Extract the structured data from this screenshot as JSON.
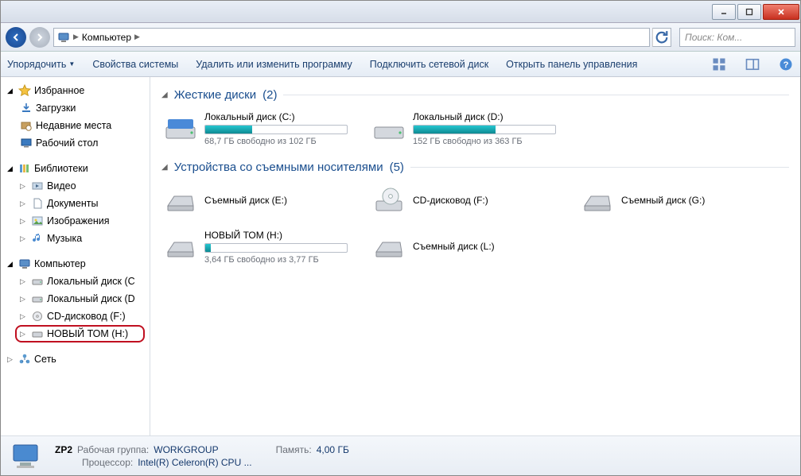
{
  "titlebar": {
    "minimize": "_",
    "maximize": "▢",
    "close": "✕"
  },
  "nav": {
    "breadcrumb_root_icon": "computer",
    "breadcrumb_label": "Компьютер",
    "search_placeholder": "Поиск: Ком..."
  },
  "toolbar": {
    "organize": "Упорядочить",
    "sys_props": "Свойства системы",
    "uninstall": "Удалить или изменить программу",
    "map_drive": "Подключить сетевой диск",
    "control_panel": "Открыть панель управления"
  },
  "sidebar": {
    "favorites": {
      "label": "Избранное",
      "items": [
        {
          "icon": "download",
          "label": "Загрузки"
        },
        {
          "icon": "recent",
          "label": "Недавние места"
        },
        {
          "icon": "desktop",
          "label": "Рабочий стол"
        }
      ]
    },
    "libraries": {
      "label": "Библиотеки",
      "items": [
        {
          "icon": "video",
          "label": "Видео"
        },
        {
          "icon": "doc",
          "label": "Документы"
        },
        {
          "icon": "image",
          "label": "Изображения"
        },
        {
          "icon": "music",
          "label": "Музыка"
        }
      ]
    },
    "computer": {
      "label": "Компьютер",
      "items": [
        {
          "icon": "hdd",
          "label": "Локальный диск (C"
        },
        {
          "icon": "hdd",
          "label": "Локальный диск (D"
        },
        {
          "icon": "cd",
          "label": "CD-дисковод (F:)"
        },
        {
          "icon": "drive",
          "label": "НОВЫЙ ТОМ (H:)",
          "highlighted": true
        }
      ]
    },
    "network": {
      "label": "Сеть"
    }
  },
  "main": {
    "hdd_section": {
      "title": "Жесткие диски",
      "count": "(2)"
    },
    "hdd": [
      {
        "name": "Локальный диск (C:)",
        "free": "68,7 ГБ свободно из 102 ГБ",
        "fill": 33
      },
      {
        "name": "Локальный диск (D:)",
        "free": "152 ГБ свободно из 363 ГБ",
        "fill": 58
      }
    ],
    "removable_section": {
      "title": "Устройства со съемными носителями",
      "count": "(5)"
    },
    "removable": [
      {
        "name": "Съемный диск (E:)",
        "icon": "removable"
      },
      {
        "name": "CD-дисковод (F:)",
        "icon": "cd"
      },
      {
        "name": "Съемный диск (G:)",
        "icon": "removable"
      },
      {
        "name": "НОВЫЙ ТОМ (H:)",
        "icon": "removable",
        "free": "3,64 ГБ свободно из 3,77 ГБ",
        "fill": 4
      },
      {
        "name": "Съемный диск (L:)",
        "icon": "removable"
      }
    ]
  },
  "status": {
    "hostname": "ZP2",
    "workgroup_label": "Рабочая группа:",
    "workgroup": "WORKGROUP",
    "memory_label": "Память:",
    "memory": "4,00 ГБ",
    "cpu_label": "Процессор:",
    "cpu": "Intel(R) Celeron(R) CPU ..."
  }
}
